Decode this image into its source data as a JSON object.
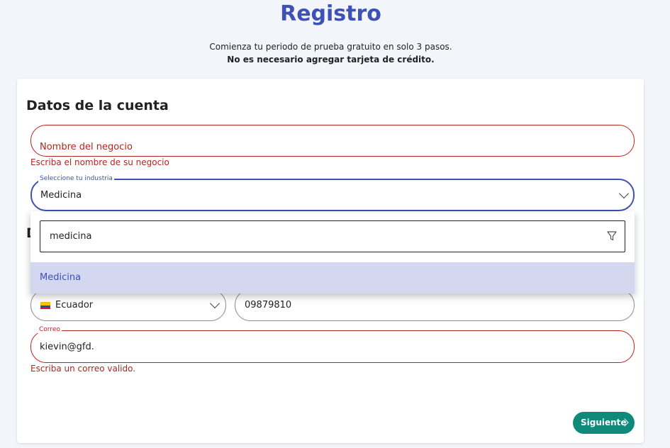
{
  "header": {
    "title": "Registro",
    "subtitle_line1": "Comienza tu periodo de prueba gratuito en solo 3 pasos.",
    "subtitle_line2": "No es necesario agregar tarjeta de crédito."
  },
  "account_section": {
    "title": "Datos de la cuenta",
    "business_name": {
      "placeholder": "Nombre del negocio",
      "value": "",
      "error": "Escriba el nombre de su negocio"
    },
    "industry": {
      "label": "Seleccione tu industria",
      "value": "Medicina",
      "filter_value": "medicina",
      "options": [
        "Medicina"
      ]
    }
  },
  "hidden_section_initial": "D",
  "contact": {
    "country": {
      "value": "Ecuador",
      "flag_icon": "ecuador-flag-icon"
    },
    "phone": {
      "value": "09879810"
    },
    "email": {
      "label": "Correo",
      "value": "kievin@gfd.",
      "error": "Escriba un correo valido."
    }
  },
  "actions": {
    "next_label": "Siguiente"
  },
  "colors": {
    "primary": "#3f51b5",
    "error": "#b3261e",
    "accent": "#0f8a7a",
    "option_highlight": "#d3d7f0"
  }
}
